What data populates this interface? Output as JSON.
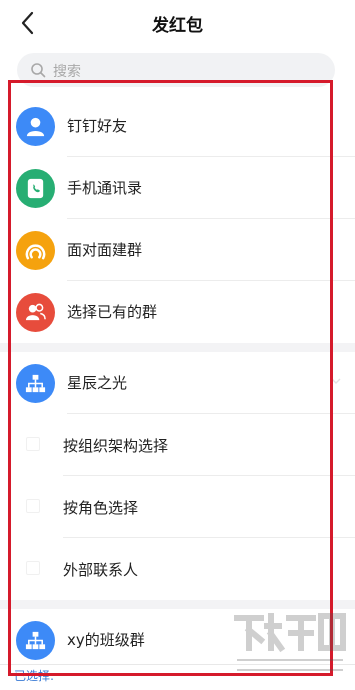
{
  "header": {
    "title": "发红包"
  },
  "search": {
    "placeholder": "搜索"
  },
  "contacts": [
    {
      "label": "钉钉好友",
      "icon": "person-icon",
      "color": "#3d8af7"
    },
    {
      "label": "手机通讯录",
      "icon": "phone-book-icon",
      "color": "#27ae73"
    },
    {
      "label": "面对面建群",
      "icon": "wave-icon",
      "color": "#f5a20e"
    },
    {
      "label": "选择已有的群",
      "icon": "group-icon",
      "color": "#e74c3c"
    }
  ],
  "organizations": [
    {
      "label": "星辰之光",
      "icon": "org-icon",
      "color": "#3d8af7",
      "options": [
        "按组织架构选择",
        "按角色选择",
        "外部联系人"
      ]
    },
    {
      "label": "xy的班级群",
      "icon": "org-icon",
      "color": "#3d8af7"
    }
  ],
  "footer": {
    "selected_label": "已选择:"
  },
  "colors": {
    "highlight": "#d51a2b",
    "accent": "#3a7bd5"
  }
}
